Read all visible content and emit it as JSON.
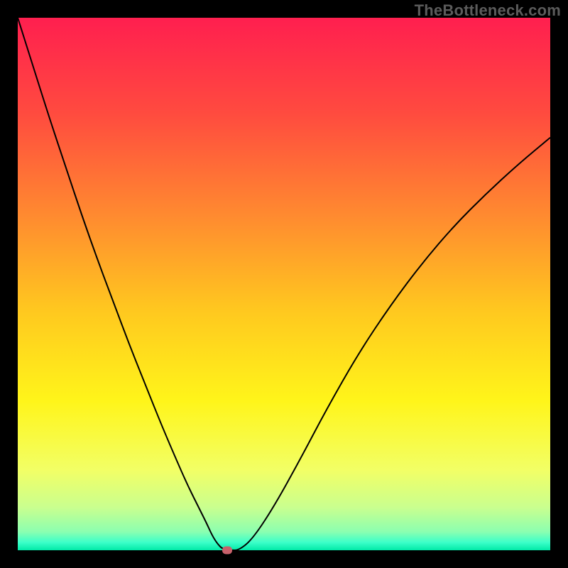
{
  "watermark": "TheBottleneck.com",
  "colors": {
    "frame_bg": "#000000",
    "curve": "#000000",
    "marker": "#c9616b",
    "watermark_text": "#5b5b5b",
    "gradient_stops": [
      {
        "offset": 0.0,
        "color": "#ff1f4f"
      },
      {
        "offset": 0.18,
        "color": "#ff4b3f"
      },
      {
        "offset": 0.38,
        "color": "#ff8d2f"
      },
      {
        "offset": 0.55,
        "color": "#ffc81f"
      },
      {
        "offset": 0.72,
        "color": "#fff51a"
      },
      {
        "offset": 0.85,
        "color": "#f2ff66"
      },
      {
        "offset": 0.92,
        "color": "#c9ff8f"
      },
      {
        "offset": 0.965,
        "color": "#8cffb0"
      },
      {
        "offset": 0.985,
        "color": "#3dffc9"
      },
      {
        "offset": 1.0,
        "color": "#00e9a7"
      }
    ]
  },
  "chart_data": {
    "type": "line",
    "title": "",
    "xlabel": "",
    "ylabel": "",
    "xlim": [
      0,
      100
    ],
    "ylim": [
      0,
      100
    ],
    "grid": false,
    "description": "Bottleneck severity curve. Y axis is bottleneck percentage (0 at bottom = balanced, 100 at top = fully bottlenecked). X axis is relative component strength. Curve dips to zero at the balance point (~38) and rises on both sides. Background vertical gradient maps severity: red at top through orange/yellow to green at bottom. A small highlighted marker sits at the balance point on the baseline.",
    "x": [
      0,
      3,
      6,
      9,
      12,
      15,
      18,
      21,
      24,
      27,
      30,
      32,
      34,
      35.5,
      36.5,
      37.5,
      38.5,
      40,
      41.5,
      44,
      48,
      53,
      58,
      64,
      70,
      76,
      82,
      88,
      94,
      100
    ],
    "values": [
      100,
      90.5,
      81,
      72,
      63,
      54.5,
      46.5,
      38.5,
      31,
      23.5,
      16.5,
      12,
      8,
      5,
      2.8,
      1.2,
      0.2,
      0,
      0,
      2,
      8,
      17,
      26.5,
      37,
      46,
      54,
      61,
      67,
      72.5,
      77.5
    ],
    "marker_point": {
      "x": 39.3,
      "y": 0
    }
  }
}
